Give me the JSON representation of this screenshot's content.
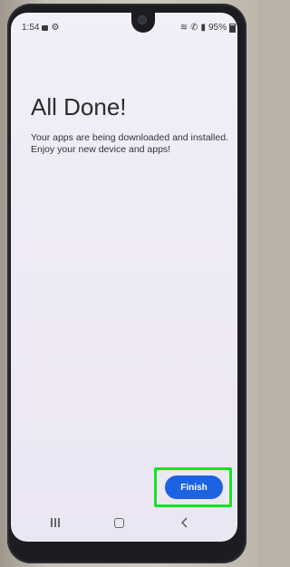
{
  "status_bar": {
    "time": "1:54",
    "battery": "95%",
    "icons": [
      "notification-icon",
      "settings-icon",
      "wifi-icon",
      "call-icon",
      "signal-icon",
      "battery-icon"
    ]
  },
  "content": {
    "title": "All Done!",
    "description": "Your apps are being downloaded and installed. Enjoy your new device and apps!"
  },
  "actions": {
    "finish_label": "Finish"
  },
  "nav": {
    "icons": [
      "recents-icon",
      "home-icon",
      "back-icon"
    ]
  },
  "colors": {
    "accent": "#1b63e0",
    "highlight": "#17e322",
    "screen_bg": "#efebf6"
  }
}
